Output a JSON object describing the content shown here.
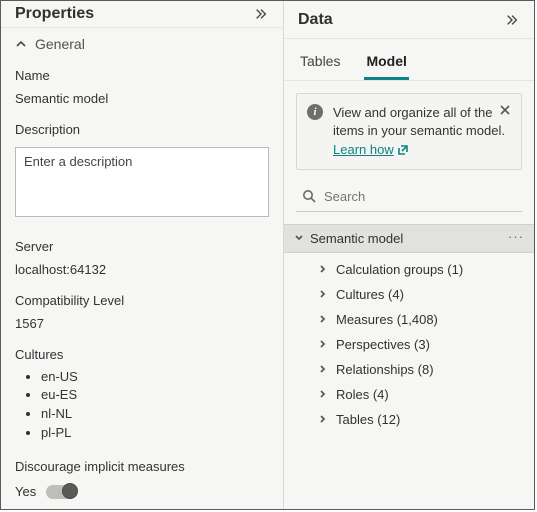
{
  "properties": {
    "title": "Properties",
    "section_general": "General",
    "name_label": "Name",
    "name_value": "Semantic model",
    "description_label": "Description",
    "description_placeholder": "Enter a description",
    "server_label": "Server",
    "server_value": "localhost:64132",
    "compat_label": "Compatibility Level",
    "compat_value": "1567",
    "cultures_label": "Cultures",
    "cultures": [
      "en-US",
      "eu-ES",
      "nl-NL",
      "pl-PL"
    ],
    "discourage_label": "Discourage implicit measures",
    "discourage_value": "Yes"
  },
  "data": {
    "title": "Data",
    "tabs": {
      "tables": "Tables",
      "model": "Model"
    },
    "info_text": "View and organize all of the items in your semantic model.",
    "info_link": "Learn how",
    "search_placeholder": "Search",
    "root_label": "Semantic model",
    "items": [
      {
        "label": "Calculation groups (1)"
      },
      {
        "label": "Cultures (4)"
      },
      {
        "label": "Measures (1,408)"
      },
      {
        "label": "Perspectives (3)"
      },
      {
        "label": "Relationships (8)"
      },
      {
        "label": "Roles (4)"
      },
      {
        "label": "Tables (12)"
      }
    ]
  }
}
